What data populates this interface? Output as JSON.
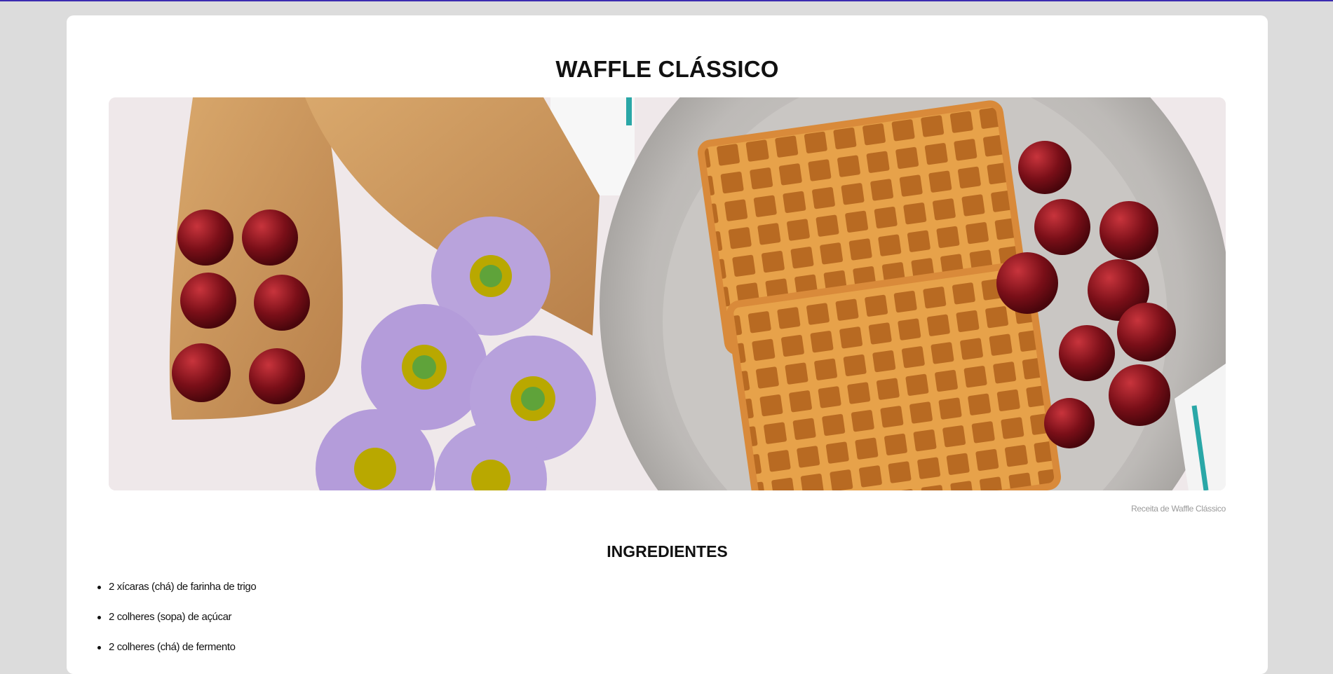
{
  "page": {
    "title": "WAFFLE CLÁSSICO",
    "hero_image": {
      "caption": "Receita de Waffle Clássico",
      "subject": "waffles-cherries-flowers-photo"
    },
    "ingredients": {
      "heading": "INGREDIENTES",
      "items": [
        "2 xícaras (chá) de farinha de trigo",
        "2 colheres (sopa) de açúcar",
        "2 colheres (chá) de fermento"
      ]
    }
  },
  "colors": {
    "background": "#dcdcdc",
    "card": "#ffffff",
    "accent_line": "#3b2bb0"
  }
}
